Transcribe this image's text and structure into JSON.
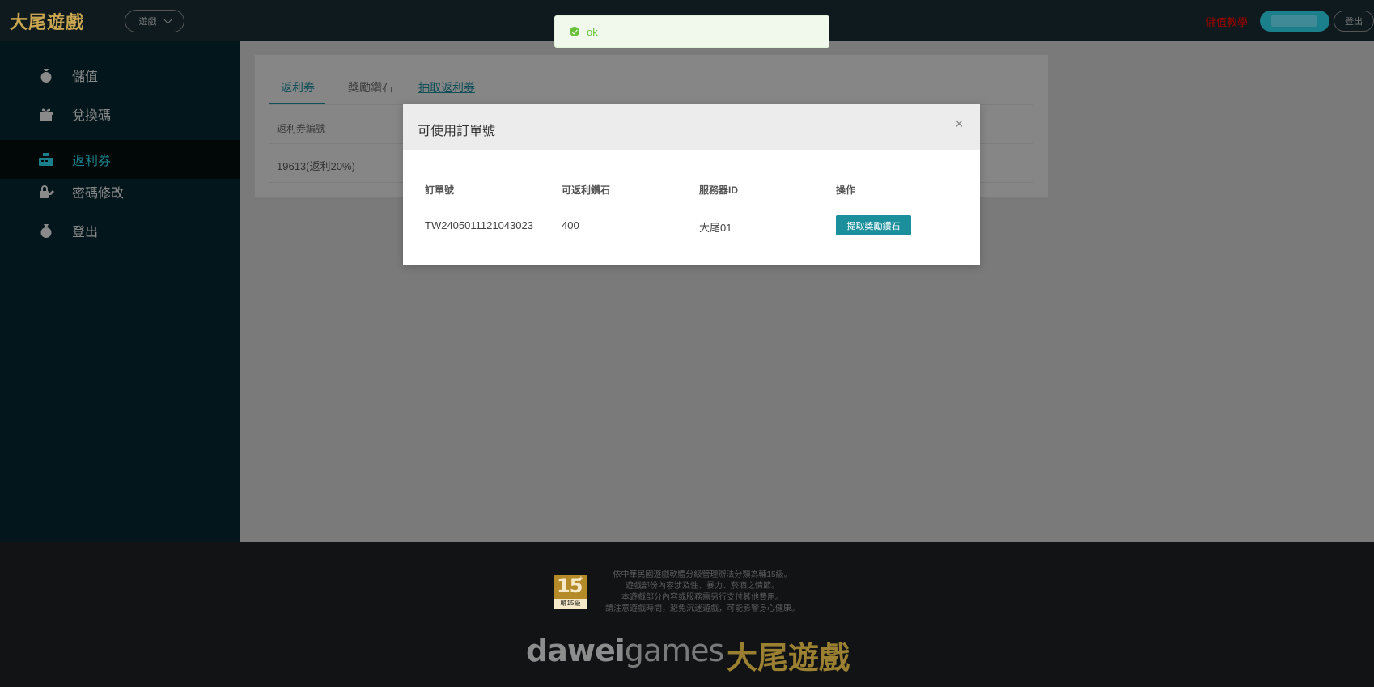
{
  "header": {
    "logo": "大尾遊戲",
    "game_select": "遊戲",
    "top_link": "儲值教學",
    "logout": "登出"
  },
  "sidebar": {
    "items": [
      {
        "label": "儲值",
        "icon": "money-bag-icon"
      },
      {
        "label": "兌換碼",
        "icon": "gift-icon"
      },
      {
        "label": "返利券",
        "icon": "cash-register-icon"
      },
      {
        "label": "密碼修改",
        "icon": "edit-lock-icon"
      },
      {
        "label": "登出",
        "icon": "money-bag-icon"
      }
    ],
    "active_index": 2
  },
  "main": {
    "tabs": [
      {
        "label": "返利券"
      },
      {
        "label": "獎勵鑽石"
      },
      {
        "label": "抽取返利券"
      }
    ],
    "table": {
      "header": "返利券編號",
      "rows": [
        "19613(返利20%)"
      ]
    }
  },
  "toast": {
    "message": "ok"
  },
  "modal": {
    "title": "可使用訂單號",
    "close": "×",
    "columns": [
      "訂單號",
      "可返利鑽石",
      "服務器ID",
      "操作"
    ],
    "rows": [
      {
        "order": "TW2405011121043023",
        "diamonds": "400",
        "server": "大尾01",
        "action": "提取獎勵鑽石"
      }
    ]
  },
  "footer": {
    "rating_number": "15",
    "rating_plus": "+",
    "rating_label": "輔15級",
    "rating_lines": [
      "依中華民國遊戲軟體分級管理辦法分類為輔15級。",
      "遊戲部份內容涉及性、暴力、菸酒之情節。",
      "本遊戲部分內容或服務需另行支付其他費用。",
      "請注意遊戲時間，避免沉迷遊戲，可能影響身心健康。"
    ],
    "brand_en_bold": "dawei",
    "brand_en_light": "games",
    "brand_zh": "大尾遊戲"
  }
}
